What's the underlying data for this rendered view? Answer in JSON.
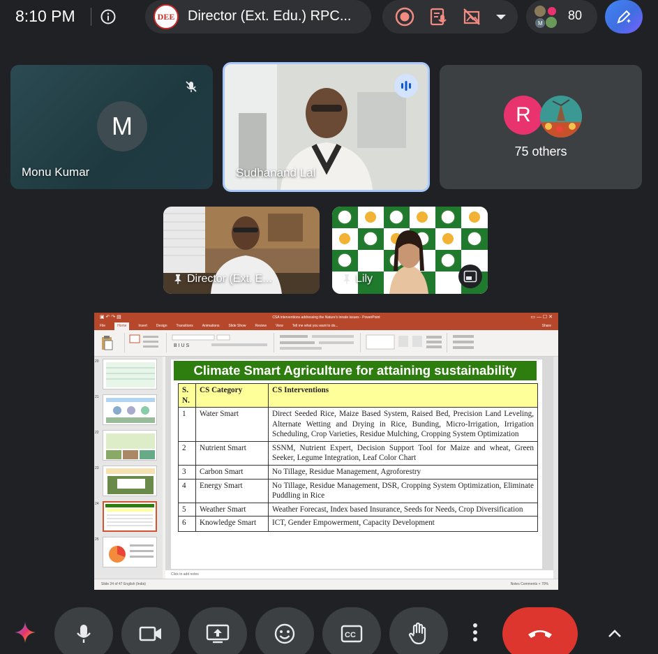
{
  "status": {
    "time": "8:10 PM"
  },
  "meeting": {
    "logo_text": "DEE",
    "title": "Director (Ext. Edu.) RPC..."
  },
  "participants": {
    "count": "80",
    "tiles": [
      {
        "name": "Monu Kumar",
        "initial": "M"
      },
      {
        "name": "Sudhanand Lal"
      },
      {
        "avatar_initial": "R",
        "label": "75 others"
      },
      {
        "name": "Director (Ext. E..."
      },
      {
        "name": "Lily"
      }
    ]
  },
  "presentation": {
    "file_title": "CSA interventions addressing the Nature's innate issues - PowerPoint",
    "tabs": [
      "File",
      "Home",
      "Insert",
      "Design",
      "Transitions",
      "Animations",
      "Slide Show",
      "Review",
      "View",
      "Tell me what you want to do..."
    ],
    "share_label": "Share",
    "thumb_numbers": [
      "20",
      "21",
      "22",
      "23",
      "24",
      "25"
    ],
    "notes_placeholder": "Click to add notes",
    "status_left": "Slide 24 of 47    English (India)",
    "status_right": "Notes    Comments    +    70%",
    "slide": {
      "title": "Climate Smart Agriculture for attaining sustainability",
      "headers": [
        "S. N.",
        "CS Category",
        "CS Interventions"
      ],
      "rows": [
        {
          "sn": "1",
          "category": "Water Smart",
          "interventions": "Direct Seeded Rice, Maize Based System, Raised Bed, Precision Land Leveling, Alternate Wetting and Drying in Rice, Bunding, Micro-Irrigation, Irrigation Scheduling, Crop Varieties, Residue Mulching, Cropping System Optimization"
        },
        {
          "sn": "2",
          "category": "Nutrient Smart",
          "interventions": "SSNM, Nutrient Expert, Decision Support Tool for Maize and wheat, Green Seeker, Legume Integration, Leaf Color Chart"
        },
        {
          "sn": "3",
          "category": "Carbon Smart",
          "interventions": "No Tillage, Residue Management, Agroforestry"
        },
        {
          "sn": "4",
          "category": "Energy Smart",
          "interventions": "No Tillage, Residue Management, DSR, Cropping System Optimization, Eliminate Puddling in Rice"
        },
        {
          "sn": "5",
          "category": "Weather Smart",
          "interventions": "Weather Forecast, Index based Insurance, Seeds for Needs, Crop Diversification"
        },
        {
          "sn": "6",
          "category": "Knowledge Smart",
          "interventions": "ICT, Gender Empowerment, Capacity Development"
        }
      ]
    }
  },
  "colors": {
    "background": "#202124",
    "end_call": "#dc362e",
    "active_speaker": "#a8c7fa",
    "slide_title_bg": "#2e7d0f",
    "table_header_bg": "#ffff99"
  }
}
